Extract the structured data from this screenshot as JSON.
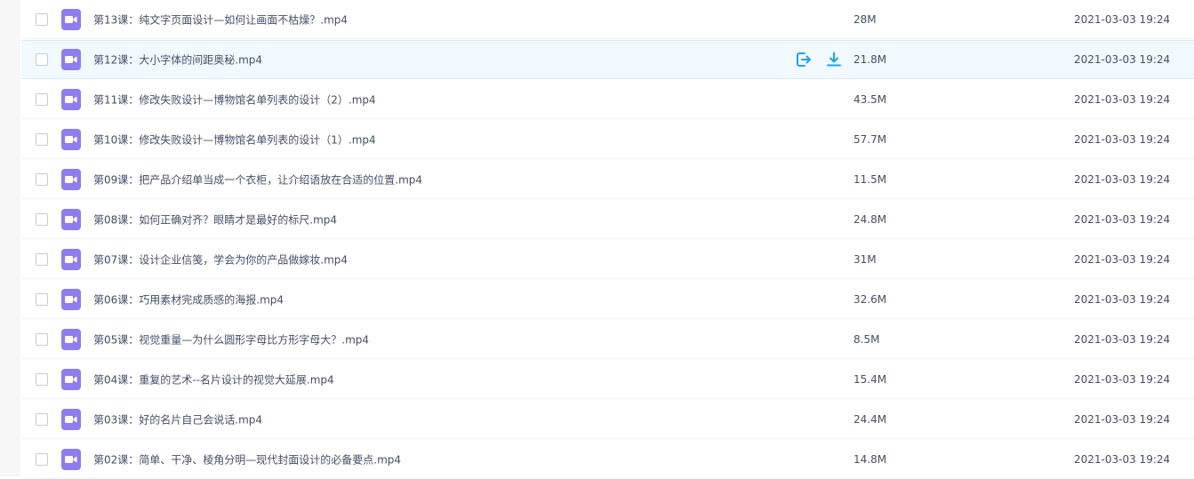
{
  "colors": {
    "icon_background": "#8e7cf0",
    "action_accent": "#1da3ee",
    "text": "#424e67",
    "row_hover": "#f2f9ff"
  },
  "files": [
    {
      "name": "第13课：纯文字页面设计—如何让画面不枯燥？.mp4",
      "size": "28M",
      "date": "2021-03-03 19:24",
      "hovered": false
    },
    {
      "name": "第12课：大小字体的间距奥秘.mp4",
      "size": "21.8M",
      "date": "2021-03-03 19:24",
      "hovered": true
    },
    {
      "name": "第11课：修改失败设计—博物馆名单列表的设计（2）.mp4",
      "size": "43.5M",
      "date": "2021-03-03 19:24",
      "hovered": false
    },
    {
      "name": "第10课：修改失败设计—博物馆名单列表的设计（1）.mp4",
      "size": "57.7M",
      "date": "2021-03-03 19:24",
      "hovered": false
    },
    {
      "name": "第09课：把产品介绍单当成一个衣柜，让介绍语放在合适的位置.mp4",
      "size": "11.5M",
      "date": "2021-03-03 19:24",
      "hovered": false
    },
    {
      "name": "第08课：如何正确对齐？眼睛才是最好的标尺.mp4",
      "size": "24.8M",
      "date": "2021-03-03 19:24",
      "hovered": false
    },
    {
      "name": "第07课：设计企业信笺，学会为你的产品做嫁妆.mp4",
      "size": "31M",
      "date": "2021-03-03 19:24",
      "hovered": false
    },
    {
      "name": "第06课：巧用素材完成质感的海报.mp4",
      "size": "32.6M",
      "date": "2021-03-03 19:24",
      "hovered": false
    },
    {
      "name": "第05课：视觉重量—为什么圆形字母比方形字母大？.mp4",
      "size": "8.5M",
      "date": "2021-03-03 19:24",
      "hovered": false
    },
    {
      "name": "第04课：重复的艺术--名片设计的视觉大延展.mp4",
      "size": "15.4M",
      "date": "2021-03-03 19:24",
      "hovered": false
    },
    {
      "name": "第03课：好的名片自己会说话.mp4",
      "size": "24.4M",
      "date": "2021-03-03 19:24",
      "hovered": false
    },
    {
      "name": "第02课：简单、干净、棱角分明—现代封面设计的必备要点.mp4",
      "size": "14.8M",
      "date": "2021-03-03 19:24",
      "hovered": false
    }
  ],
  "row_actions": {
    "share_icon": "share-icon",
    "download_icon": "download-icon"
  }
}
